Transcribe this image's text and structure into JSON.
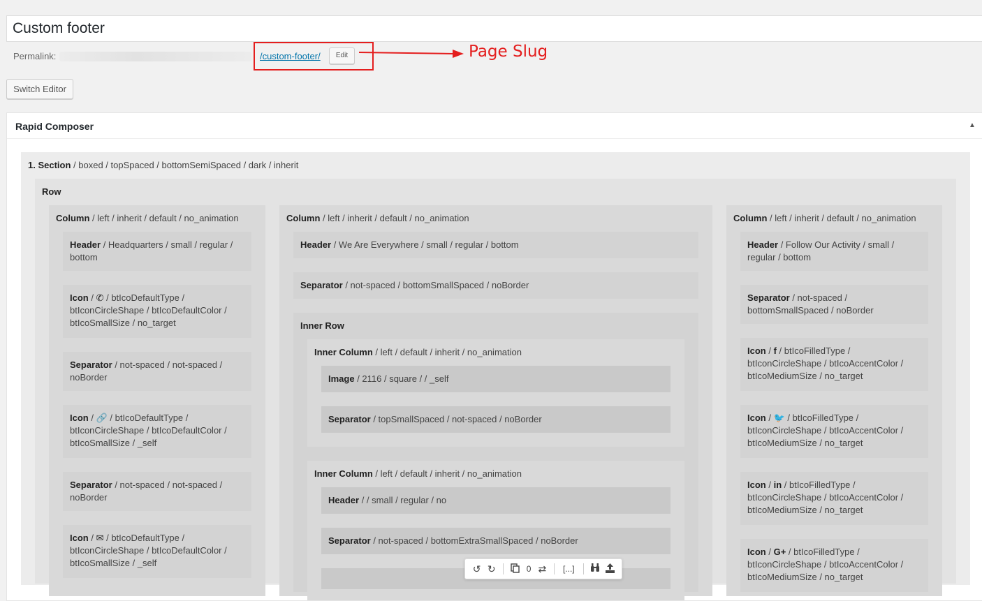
{
  "post": {
    "title": "Custom footer",
    "permalink_label": "Permalink:",
    "slug": "/custom-footer/",
    "edit_label": "Edit",
    "switch_editor_label": "Switch Editor"
  },
  "annotation": {
    "label": "Page Slug",
    "color": "#e41e1e"
  },
  "composer": {
    "title": "Rapid Composer",
    "section": {
      "title": "1. Section",
      "attrs": " / boxed / topSpaced / bottomSemiSpaced / dark / inherit"
    },
    "row": {
      "title": "Row"
    },
    "columns": [
      {
        "title": "Column",
        "attrs": " / left / inherit / default / no_animation",
        "items": [
          {
            "type": "Header",
            "text": " / Headquarters / small / regular / bottom"
          },
          {
            "type": "Icon",
            "icon": "phone-icon",
            "glyph": "✆",
            "text": " / btIcoDefaultType / btIconCircleShape / btIcoDefaultColor / btIcoSmallSize / no_target"
          },
          {
            "type": "Separator",
            "text": " / not-spaced / not-spaced / noBorder"
          },
          {
            "type": "Icon",
            "icon": "link-icon",
            "glyph": "🔗",
            "text": " / btIcoDefaultType / btIconCircleShape / btIcoDefaultColor / btIcoSmallSize / _self"
          },
          {
            "type": "Separator",
            "text": " / not-spaced / not-spaced / noBorder"
          },
          {
            "type": "Icon",
            "icon": "envelope-icon",
            "glyph": "✉",
            "text": " / btIcoDefaultType / btIconCircleShape / btIcoDefaultColor / btIcoSmallSize / _self"
          }
        ]
      },
      {
        "title": "Column",
        "attrs": " / left / inherit / default / no_animation",
        "items": [
          {
            "type": "Header",
            "text": " / We Are Everywhere / small / regular / bottom"
          },
          {
            "type": "Separator",
            "text": " / not-spaced / bottomSmallSpaced / noBorder"
          }
        ],
        "inner_row": {
          "title": "Inner Row",
          "inner_columns": [
            {
              "title": "Inner Column",
              "attrs": " / left / default / inherit / no_animation",
              "items": [
                {
                  "type": "Image",
                  "text": " / 2116 / square / / _self"
                },
                {
                  "type": "Separator",
                  "text": " / topSmallSpaced / not-spaced / noBorder"
                }
              ]
            },
            {
              "title": "Inner Column",
              "attrs": " / left / default / inherit / no_animation",
              "items": [
                {
                  "type": "Header",
                  "text": " / / small / regular / no"
                },
                {
                  "type": "Separator",
                  "text": " / not-spaced / bottomExtraSmallSpaced / noBorder"
                }
              ]
            }
          ]
        }
      },
      {
        "title": "Column",
        "attrs": " / left / inherit / default / no_animation",
        "items": [
          {
            "type": "Header",
            "text": " / Follow Our Activity / small / regular / bottom"
          },
          {
            "type": "Separator",
            "text": " / not-spaced / bottomSmallSpaced / noBorder"
          },
          {
            "type": "Icon",
            "icon": "facebook-icon",
            "glyph": "f",
            "text": " / btIcoFilledType / btIconCircleShape / btIcoAccentColor / btIcoMediumSize / no_target"
          },
          {
            "type": "Icon",
            "icon": "twitter-icon",
            "glyph": "🐦",
            "text": " / btIcoFilledType / btIconCircleShape / btIcoAccentColor / btIcoMediumSize / no_target"
          },
          {
            "type": "Icon",
            "icon": "linkedin-icon",
            "glyph": "in",
            "text": " / btIcoFilledType / btIconCircleShape / btIcoAccentColor / btIcoMediumSize / no_target"
          },
          {
            "type": "Icon",
            "icon": "google-plus-icon",
            "glyph": "G+",
            "text": " / btIcoFilledType / btIconCircleShape / btIcoAccentColor / btIcoMediumSize / no_target"
          }
        ]
      }
    ]
  },
  "toolbar": {
    "undo": "↺",
    "redo": "↻",
    "clipboard_count": "0",
    "ellipsis": "[...]"
  }
}
